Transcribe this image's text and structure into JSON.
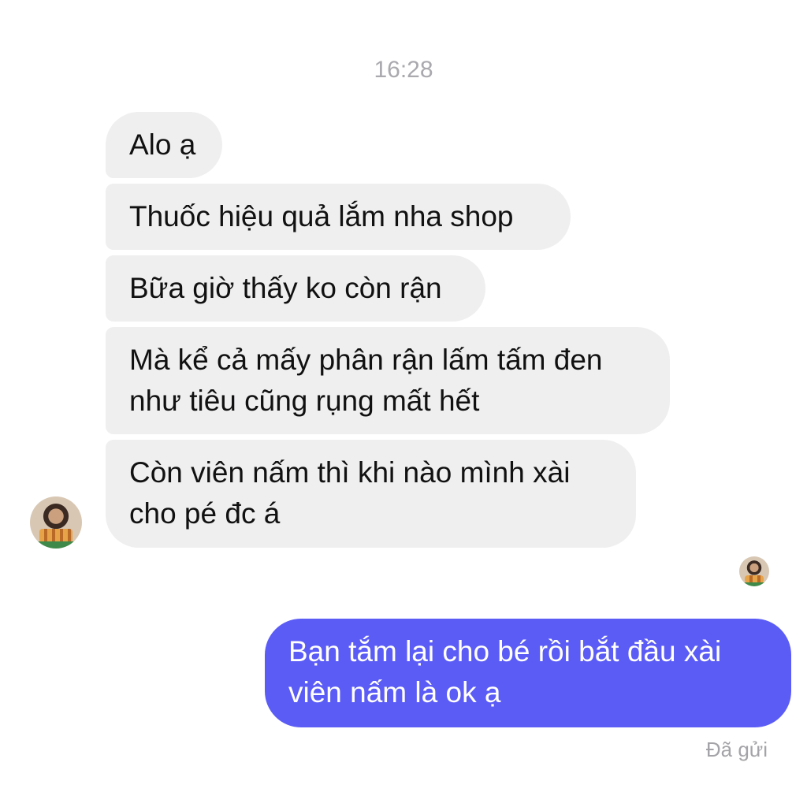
{
  "conversation": {
    "timestamp": "16:28",
    "incoming_messages": [
      {
        "lines": [
          "Alo ạ"
        ]
      },
      {
        "lines": [
          "Thuốc hiệu quả lắm nha shop"
        ]
      },
      {
        "lines": [
          "Bữa giờ thấy ko còn rận"
        ]
      },
      {
        "lines": [
          "Mà kể cả mấy phân rận lấm tấm đen",
          "như tiêu cũng rụng mất hết"
        ]
      },
      {
        "lines": [
          "Còn viên nấm thì khi nào mình xài",
          "cho pé đc á"
        ]
      }
    ],
    "outgoing_messages": [
      {
        "lines": [
          "Bạn tắm lại cho bé rồi bắt đầu xài",
          "viên nấm là ok ạ"
        ]
      }
    ],
    "delivery_status": "Đã gửi"
  },
  "colors": {
    "incoming_bubble": "#efeff0",
    "outgoing_bubble": "#5b5cf6",
    "timestamp_text": "#a9a9ae"
  },
  "icons": {
    "sender_avatar": "profile-photo",
    "read_receipt_avatar": "profile-photo"
  }
}
